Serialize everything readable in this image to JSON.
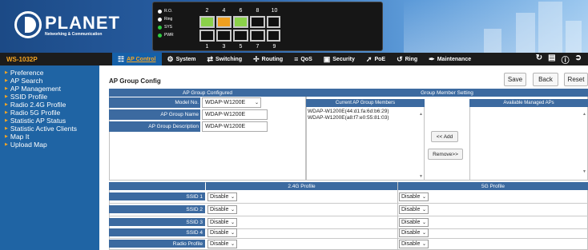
{
  "brand": {
    "logo_text": "PLANET",
    "logo_subtitle": "Networking & Communication"
  },
  "device_panel": {
    "leds": [
      "R.O.",
      "Ring",
      "SYS",
      "PWR"
    ],
    "top_port_numbers": [
      "2",
      "4",
      "6",
      "8",
      "10"
    ],
    "bottom_port_numbers": [
      "1",
      "3",
      "5",
      "7",
      "9"
    ]
  },
  "navbar": {
    "model": "WS-1032P",
    "menu": [
      {
        "label": "AP Control",
        "icon": "ap-icon",
        "active": true
      },
      {
        "label": "System",
        "icon": "gear-icon"
      },
      {
        "label": "Switching",
        "icon": "switching-icon"
      },
      {
        "label": "Routing",
        "icon": "routing-icon"
      },
      {
        "label": "QoS",
        "icon": "qos-icon"
      },
      {
        "label": "Security",
        "icon": "lock-icon"
      },
      {
        "label": "PoE",
        "icon": "poe-icon"
      },
      {
        "label": "Ring",
        "icon": "ring-icon"
      },
      {
        "label": "Maintenance",
        "icon": "wrench-icon"
      }
    ],
    "right_icons": [
      "refresh-icon",
      "save-icon",
      "help-icon",
      "logout-icon"
    ]
  },
  "sidebar": {
    "items": [
      "Preference",
      "AP Search",
      "AP Management",
      "SSID Profile",
      "Radio 2.4G Profile",
      "Radio 5G Profile",
      "Statistic AP Status",
      "Statistic Active Clients",
      "Map It",
      "Upload Map"
    ]
  },
  "page": {
    "title": "AP Group Config",
    "buttons": {
      "save": "Save",
      "back": "Back",
      "reset": "Reset"
    }
  },
  "group_config": {
    "header": "AP Group Configured",
    "model_label": "Model No.",
    "model_value": "WDAP-W1200E",
    "name_label": "AP Group Name",
    "name_value": "WDAP-W1200E",
    "desc_label": "AP Group Description",
    "desc_value": "WDAP-W1200E"
  },
  "member_setting": {
    "header": "Group Member Setting",
    "current_header": "Current AP Group Members",
    "available_header": "Available Managed APs",
    "current_members": [
      "WDAP-W1200E(44:d1:fa:6d:b6:29)",
      "WDAP-W1200E(a8:f7:e0:55:81:03)"
    ],
    "add_button": "<< Add",
    "remove_button": "Remove>>"
  },
  "profiles": {
    "header_24g": "2.4G Profile",
    "header_5g": "5G Profile",
    "rows": [
      {
        "label": "SSID 1",
        "v24": "Disable",
        "v5": "Disable"
      },
      {
        "label": "SSID 2",
        "v24": "Disable",
        "v5": "Disable"
      },
      {
        "label": "SSID 3",
        "v24": "Disable",
        "v5": "Disable"
      },
      {
        "label": "SSID 4",
        "v24": "Disable",
        "v5": "Disable"
      },
      {
        "label": "Radio Profile",
        "v24": "Disable",
        "v5": "Disable"
      }
    ]
  },
  "colors": {
    "header_blue": "#3c6aa0",
    "sidebar_blue": "#1f64a4",
    "navbar": "#1c1c1c",
    "accent_orange": "#f6a623"
  }
}
